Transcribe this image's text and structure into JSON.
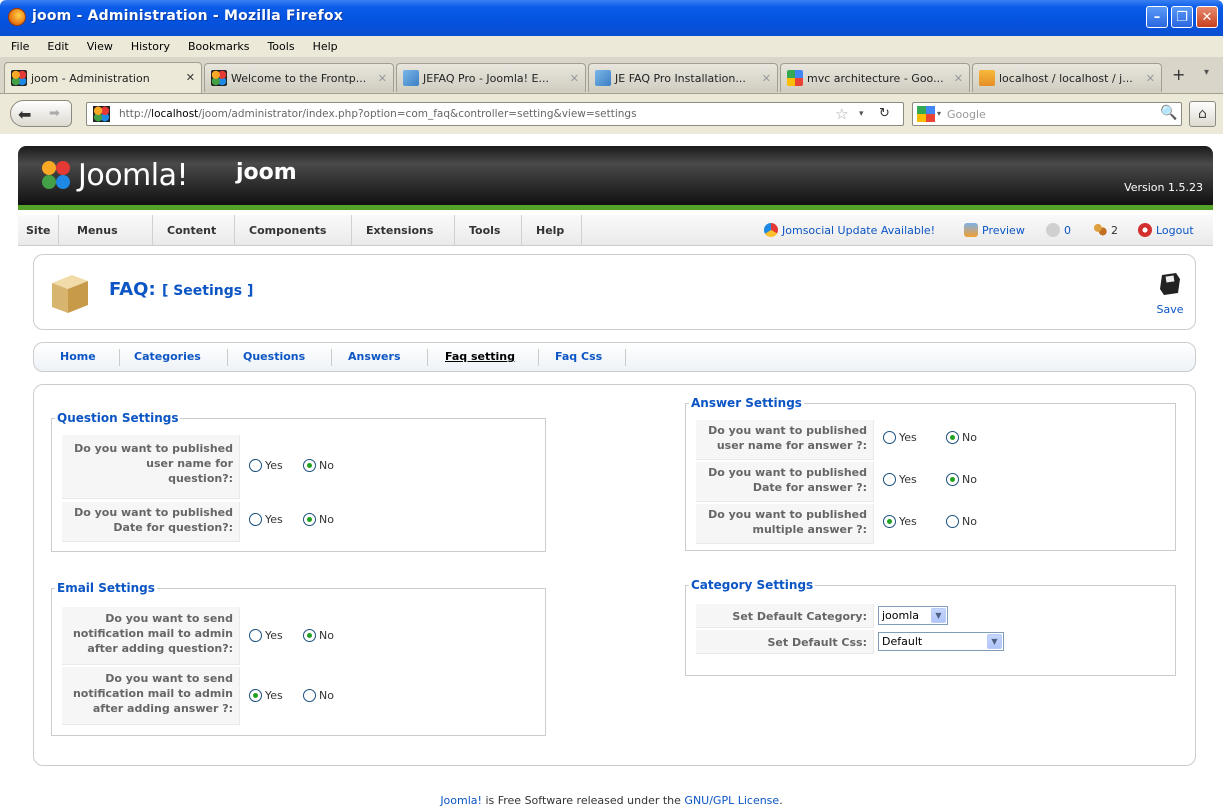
{
  "window": {
    "title": "joom - Administration - Mozilla Firefox"
  },
  "menubar": [
    "File",
    "Edit",
    "View",
    "History",
    "Bookmarks",
    "Tools",
    "Help"
  ],
  "tabs": [
    {
      "label": "joom - Administration",
      "favicon": "joomla-icon"
    },
    {
      "label": "Welcome to the Frontp...",
      "favicon": "joomla-icon"
    },
    {
      "label": "JEFAQ Pro - Joomla! E...",
      "favicon": "jefaq-icon"
    },
    {
      "label": "JE FAQ Pro Installation...",
      "favicon": "jefaq-icon"
    },
    {
      "label": "mvc architecture - Goo...",
      "favicon": "google-icon"
    },
    {
      "label": "localhost / localhost / j...",
      "favicon": "phpmyadmin-icon"
    }
  ],
  "nav": {
    "url_prefix": "http://",
    "url_host": "localhost",
    "url_path": "/joom/administrator/index.php?option=com_faq&controller=setting&view=settings",
    "search_placeholder": "Google"
  },
  "joomla": {
    "brand": "Joomla!",
    "site_name": "joom",
    "version": "Version 1.5.23",
    "menu": [
      "Site",
      "Menus",
      "Content",
      "Components",
      "Extensions",
      "Tools",
      "Help"
    ],
    "status": {
      "update": "Jomsocial Update Available!",
      "preview": "Preview",
      "messages": "0",
      "users": "2",
      "logout": "Logout"
    }
  },
  "page": {
    "title": "FAQ:",
    "subtitle": "[ Seetings ]",
    "save_label": "Save"
  },
  "subnav": [
    "Home",
    "Categories",
    "Questions",
    "Answers",
    "Faq setting",
    "Faq Css"
  ],
  "question_settings": {
    "legend": "Question Settings",
    "rows": [
      {
        "label": "Do you want to published\nuser name for\nquestion?:",
        "selected": "No"
      },
      {
        "label": "Do you want to published\nDate for question?:",
        "selected": "No"
      }
    ]
  },
  "email_settings": {
    "legend": "Email Settings",
    "rows": [
      {
        "label": "Do you want to send\nnotification mail to admin\nafter adding question?:",
        "selected": "No"
      },
      {
        "label": "Do you want to send\nnotification mail to admin\nafter adding answer ?:",
        "selected": "Yes"
      }
    ]
  },
  "answer_settings": {
    "legend": "Answer Settings",
    "rows": [
      {
        "label": "Do you want to published\nuser name for answer ?:",
        "selected": "No"
      },
      {
        "label": "Do you want to published\nDate for answer ?:",
        "selected": "No"
      },
      {
        "label": "Do you want to published\nmultiple answer ?:",
        "selected": "Yes"
      }
    ]
  },
  "category_settings": {
    "legend": "Category Settings",
    "default_category_label": "Set Default Category:",
    "default_category_value": "joomla",
    "default_css_label": "Set Default Css:",
    "default_css_value": "Default"
  },
  "radio_labels": {
    "yes": "Yes",
    "no": "No"
  },
  "footer": {
    "link1": "Joomla!",
    "text": " is Free Software released under the ",
    "link2": "GNU/GPL License",
    "end": "."
  },
  "colors": {
    "link": "#0b55c4",
    "joomla_green": "#54a329",
    "titlebar": "#0552df"
  }
}
